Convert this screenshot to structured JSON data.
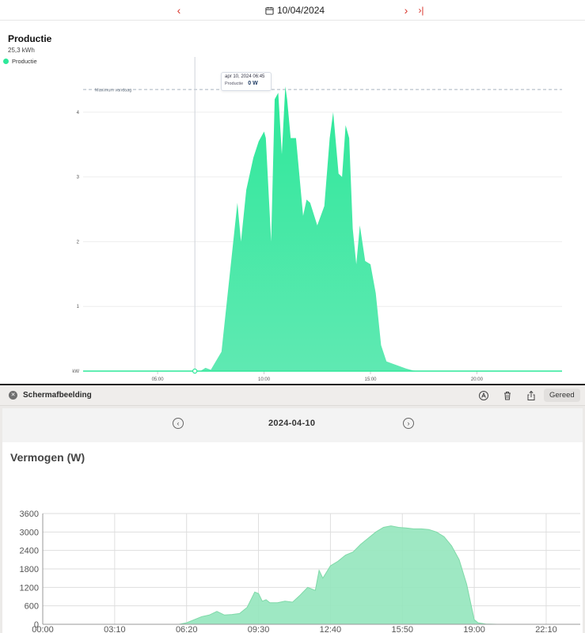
{
  "app": {
    "date_nav": {
      "date": "10/04/2024",
      "prev_icon": "chevron-left-icon",
      "next_icon": "chevron-right-icon",
      "last_icon": "skip-to-last-icon",
      "calendar_icon": "calendar-icon"
    },
    "title": "Productie",
    "total": "25,3 kWh",
    "legend_label": "Productie",
    "tooltip": {
      "date": "apr 10, 2024  06:45",
      "label": "Productie",
      "value": "0 W"
    },
    "max_label": "Maximum vandaag",
    "colors": {
      "accent": "#d9342b",
      "series": "#2ee89a",
      "series_light": "#5fe9b2"
    }
  },
  "screenshot_window": {
    "title": "Schermafbeelding",
    "done_label": "Gereed",
    "close_icon": "close-icon",
    "markup_icon": "markup-icon",
    "trash_icon": "trash-icon",
    "share_icon": "share-icon",
    "date": "2024-04-10",
    "prev_icon": "circle-chevron-left-icon",
    "next_icon": "circle-chevron-right-icon",
    "chart_title": "Vermogen (W)"
  },
  "chart_data": [
    {
      "type": "area",
      "title": "Productie",
      "ylabel": "kW",
      "xlabel": "",
      "x_ticks": [
        "05:00",
        "10:00",
        "15:00",
        "20:00"
      ],
      "y_ticks": [
        1,
        2,
        3,
        4
      ],
      "ylim": [
        0,
        5
      ],
      "xlim": [
        "01:30",
        "24:00"
      ],
      "grid": true,
      "legend": "top-left",
      "reference_line": {
        "label": "Maximum vandaag",
        "y": 4.35
      },
      "series": [
        {
          "name": "Productie",
          "color": "#2ee89a",
          "x": [
            "06:45",
            "07:00",
            "07:15",
            "07:30",
            "08:00",
            "08:45",
            "08:55",
            "09:10",
            "09:30",
            "09:45",
            "10:00",
            "10:05",
            "10:20",
            "10:30",
            "10:40",
            "10:50",
            "11:00",
            "11:05",
            "11:15",
            "11:30",
            "11:50",
            "12:00",
            "12:10",
            "12:30",
            "12:50",
            "13:05",
            "13:15",
            "13:30",
            "13:40",
            "13:50",
            "14:00",
            "14:10",
            "14:20",
            "14:30",
            "14:45",
            "15:00",
            "15:15",
            "15:30",
            "15:45",
            "16:00",
            "16:20",
            "16:40",
            "17:00",
            "17:20",
            "17:30",
            "18:00",
            "18:40",
            "19:20",
            "19:50",
            "20:30",
            "21:00"
          ],
          "y": [
            0,
            0,
            0.05,
            0.02,
            0.3,
            2.6,
            2.0,
            2.8,
            3.3,
            3.55,
            3.7,
            3.6,
            2.0,
            4.2,
            4.3,
            3.35,
            4.4,
            4.2,
            3.6,
            3.6,
            2.4,
            2.65,
            2.6,
            2.25,
            2.55,
            3.6,
            4.0,
            3.05,
            3.0,
            3.8,
            3.6,
            2.2,
            1.65,
            2.25,
            1.7,
            1.65,
            1.2,
            0.4,
            0.15,
            0.12,
            0.08,
            0.04,
            0.01,
            0,
            0,
            0,
            0,
            0,
            0,
            0,
            0
          ]
        }
      ]
    },
    {
      "type": "area",
      "title": "Vermogen (W)",
      "xlabel": "",
      "ylabel": "",
      "x_ticks": [
        "00:00",
        "03:10",
        "06:20",
        "09:30",
        "12:40",
        "15:50",
        "19:00",
        "22:10"
      ],
      "y_ticks": [
        0,
        600,
        1200,
        1800,
        2400,
        3000,
        3600
      ],
      "ylim": [
        0,
        3600
      ],
      "xlim": [
        "00:00",
        "23:40"
      ],
      "grid": true,
      "series": [
        {
          "name": "",
          "color": "#94e6bd",
          "x": [
            "00:00",
            "06:00",
            "06:20",
            "06:40",
            "07:00",
            "07:20",
            "07:40",
            "08:00",
            "08:20",
            "08:40",
            "09:00",
            "09:20",
            "09:30",
            "09:40",
            "09:50",
            "10:00",
            "10:20",
            "10:40",
            "11:00",
            "11:20",
            "11:40",
            "12:00",
            "12:10",
            "12:20",
            "12:40",
            "13:00",
            "13:20",
            "13:40",
            "14:00",
            "14:20",
            "14:40",
            "15:00",
            "15:20",
            "15:40",
            "16:00",
            "16:20",
            "16:40",
            "17:00",
            "17:20",
            "17:40",
            "18:00",
            "18:20",
            "18:40",
            "19:00",
            "19:10",
            "19:30",
            "20:00",
            "23:40"
          ],
          "y": [
            0,
            0,
            50,
            150,
            250,
            300,
            420,
            300,
            320,
            350,
            550,
            1050,
            1000,
            750,
            800,
            700,
            700,
            750,
            720,
            950,
            1200,
            1100,
            1750,
            1500,
            1900,
            2050,
            2250,
            2350,
            2600,
            2800,
            3000,
            3150,
            3200,
            3150,
            3130,
            3100,
            3100,
            3080,
            3000,
            2850,
            2550,
            2100,
            1300,
            150,
            50,
            10,
            0,
            0
          ]
        }
      ]
    }
  ]
}
